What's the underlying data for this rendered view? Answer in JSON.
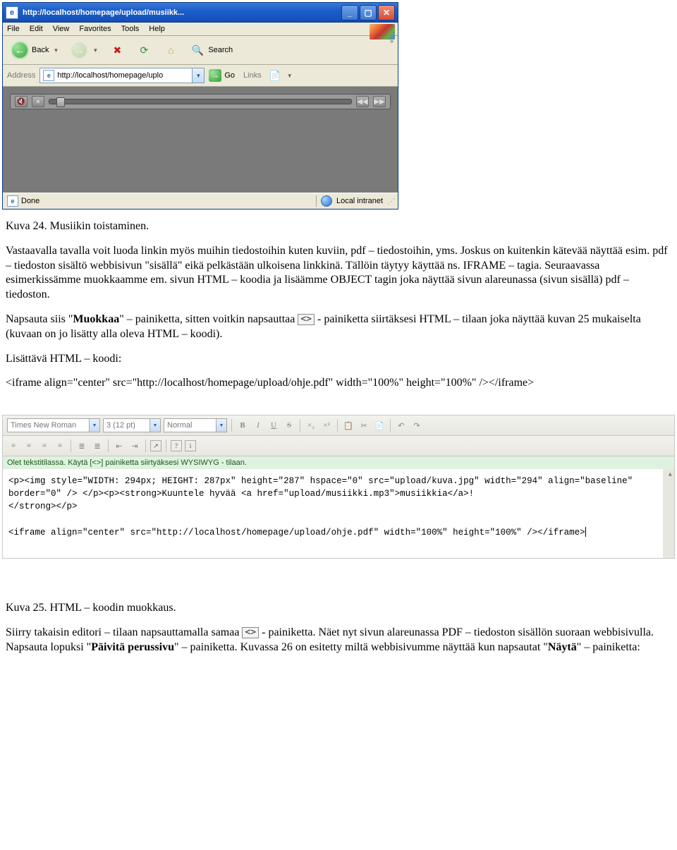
{
  "ie": {
    "title": "http://localhost/homepage/upload/musiikk...",
    "menu": {
      "file": "File",
      "edit": "Edit",
      "view": "View",
      "favorites": "Favorites",
      "tools": "Tools",
      "help": "Help"
    },
    "toolbar": {
      "back": "Back",
      "search": "Search"
    },
    "addrbar": {
      "label": "Address",
      "value": "http://localhost/homepage/uplo",
      "go": "Go",
      "links": "Links"
    },
    "status": {
      "done": "Done",
      "zone": "Local intranet"
    }
  },
  "doc": {
    "caption24": "Kuva 24. Musiikin toistaminen.",
    "p1": "Vastaavalla tavalla voit luoda linkin myös muihin tiedostoihin kuten kuviin, pdf – tiedostoihin, yms. Joskus on kuitenkin kätevää näyttää esim. pdf – tiedoston sisältö webbisivun \"sisällä\" eikä pelkästään ulkoisena linkkinä. Tällöin täytyy käyttää ns. IFRAME – tagia. Seuraavassa esimerkissämme muokkaamme em. sivun HTML – koodia ja lisäämme OBJECT tagin joka näyttää sivun alareunassa (sivun sisällä) pdf – tiedoston.",
    "p2a": "Napsauta siis \"",
    "p2b": "Muokkaa",
    "p2c": "\" – painiketta, sitten voitkin napsauttaa ",
    "p2d": " - painiketta siirtäksesi HTML – tilaan joka näyttää kuvan 25 mukaiselta (kuvaan on jo lisätty alla oleva HTML – koodi).",
    "p3": "Lisättävä HTML – koodi:",
    "p4": "<iframe align=\"center\" src=\"http://localhost/homepage/upload/ohje.pdf\" width=\"100%\" height=\"100%\" /></iframe>",
    "caption25": "Kuva 25. HTML – koodin muokkaus.",
    "p5a": "Siirry takaisin editori – tilaan napsauttamalla samaa ",
    "p5b": " - painiketta. Näet nyt sivun alareunassa PDF – tiedoston sisällön suoraan webbisivulla. Napsauta lopuksi \"",
    "p5c": "Päivitä perussivu",
    "p5d": "\" – painiketta. Kuvassa 26 on esitetty miltä webbisivumme näyttää kun napsautat \"",
    "p5e": "Näytä",
    "p5f": "\" – painiketta:"
  },
  "editor": {
    "font": "Times New Roman",
    "size": "3 (12 pt)",
    "style": "Normal",
    "info": "Olet tekstitilassa. Käytä [<>] painiketta siirtyäksesi WYSIWYG - tilaan.",
    "code_l1": "<p><img style=\"WIDTH: 294px; HEIGHT: 287px\" height=\"287\" hspace=\"0\" src=\"upload/kuva.jpg\" width=\"294\" align=\"baseline\" border=\"0\" /> </p><p><strong>Kuuntele hyvää <a href=\"upload/musiikki.mp3\">musiikkia</a>!",
    "code_l2": "</strong></p>",
    "code_l3": "<iframe align=\"center\" src=\"http://localhost/homepage/upload/ohje.pdf\" width=\"100%\" height=\"100%\" /></iframe>"
  }
}
